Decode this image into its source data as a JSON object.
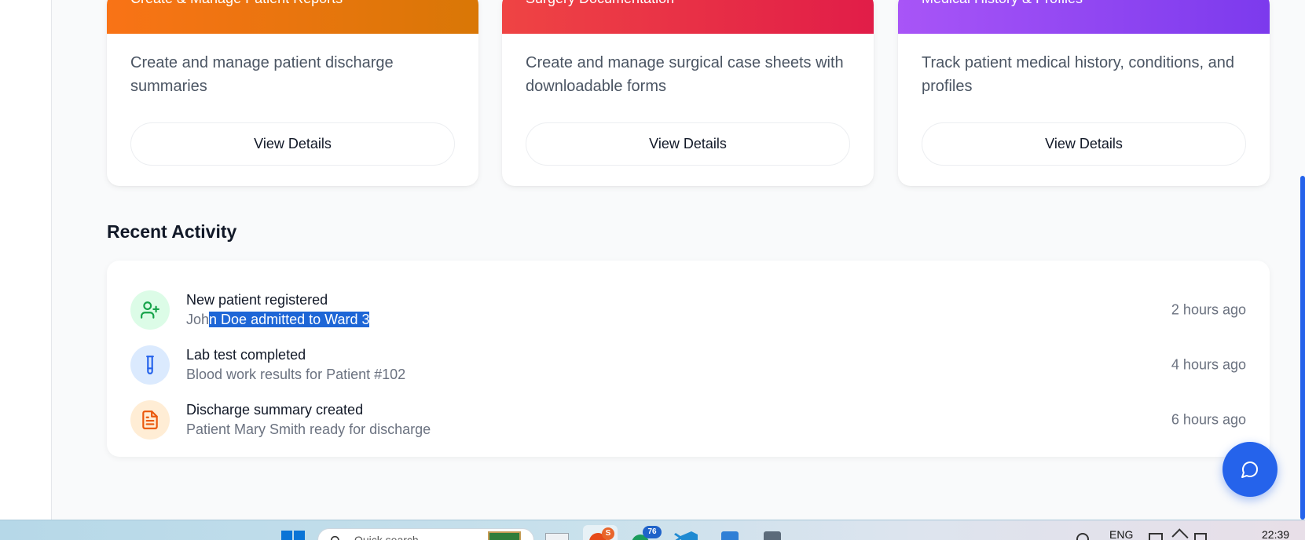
{
  "cards": [
    {
      "header": "Create & Manage Patient Reports",
      "description": "Create and manage patient discharge summaries",
      "button": "View Details",
      "gradient_from": "#f97316",
      "gradient_to": "#d97706"
    },
    {
      "header": "Surgery Documentation",
      "description": "Create and manage surgical case sheets with downloadable forms",
      "button": "View Details",
      "gradient_from": "#ef4444",
      "gradient_to": "#e11d48"
    },
    {
      "header": "Medical History & Profiles",
      "description": "Track patient medical history, conditions, and profiles",
      "button": "View Details",
      "gradient_from": "#a855f7",
      "gradient_to": "#7c3aed"
    }
  ],
  "recent_activity": {
    "title": "Recent Activity",
    "items": [
      {
        "icon": "user-plus-icon",
        "title": "New patient registered",
        "subtitle_prefix": "Joh",
        "subtitle_selected": "n Doe admitted to Ward 3",
        "time": "2 hours ago",
        "icon_bg": "#dcfce7",
        "icon_color": "#16a34a"
      },
      {
        "icon": "test-tube-icon",
        "title": "Lab test completed",
        "subtitle": "Blood work results for Patient #102",
        "time": "4 hours ago",
        "icon_bg": "#dbeafe",
        "icon_color": "#2563eb"
      },
      {
        "icon": "file-text-icon",
        "title": "Discharge summary created",
        "subtitle": "Patient Mary Smith ready for discharge",
        "time": "6 hours ago",
        "icon_bg": "#ffedd5",
        "icon_color": "#ea580c"
      }
    ]
  },
  "chat_button": {
    "icon": "message-circle-icon",
    "color": "#2563eb"
  },
  "taskbar": {
    "search_placeholder": "Quick search",
    "language": "ENG",
    "clock": "22:39",
    "badge_app1": "S",
    "badge_app2": "76"
  }
}
